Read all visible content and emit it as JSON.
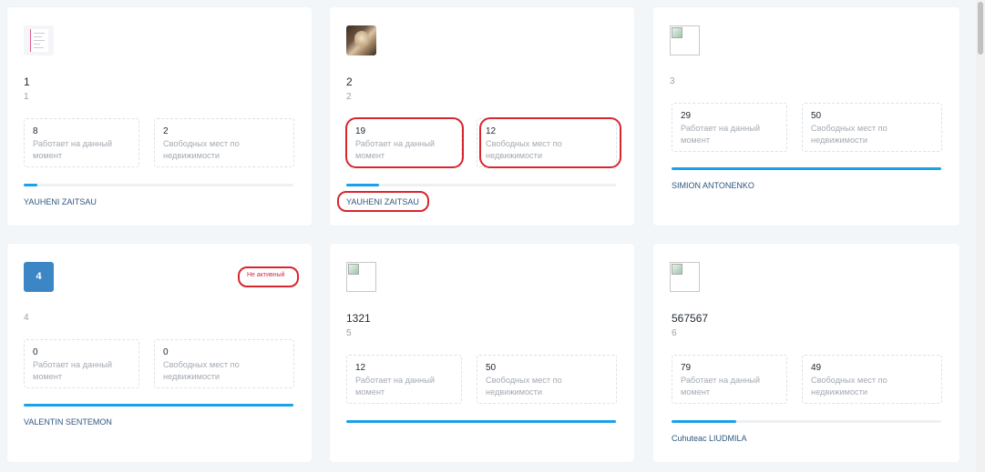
{
  "stat_labels": {
    "working": "Работает на данный момент",
    "free": "Свободных мест по недвижимости"
  },
  "accent_color": "#1ba0e9",
  "badge_color": "#c9304f",
  "annotation_color": "#d8262e",
  "cards": [
    {
      "title": "1",
      "subtitle": "1",
      "image": "document-thumbnail",
      "working": "8",
      "free": "2",
      "progress": 0.05,
      "owner": "YAUHENI ZAITSAU"
    },
    {
      "title": "2",
      "subtitle": "2",
      "image": "photo-thumbnail",
      "working": "19",
      "free": "12",
      "progress": 0.12,
      "owner": "YAUHENI ZAITSAU"
    },
    {
      "title": "",
      "subtitle": "3",
      "image": "broken-image-icon",
      "working": "29",
      "free": "50",
      "progress": 1.0,
      "owner": "SIMION ANTONENKO"
    },
    {
      "title": "",
      "subtitle": "4",
      "image": "initial-avatar",
      "image_text": "4",
      "badge": "Не активный",
      "working": "0",
      "free": "0",
      "progress": 1.0,
      "owner": "VALENTIN SENTEMON"
    },
    {
      "title": "1321",
      "subtitle": "5",
      "image": "broken-image-icon",
      "working": "12",
      "free": "50",
      "progress": 1.0,
      "owner": ""
    },
    {
      "title": "567567",
      "subtitle": "6",
      "image": "broken-image-icon",
      "working": "79",
      "free": "49",
      "progress": 0.24,
      "owner": "Cuhuteac LIUDMILA"
    }
  ]
}
